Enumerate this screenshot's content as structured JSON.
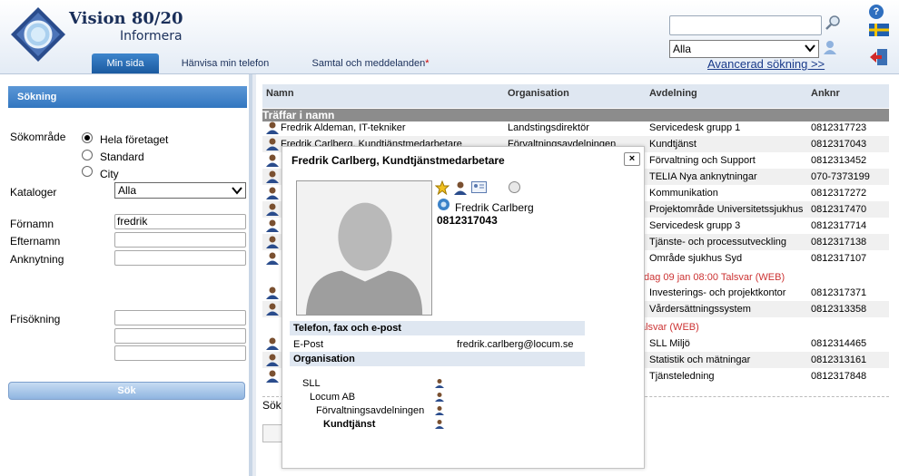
{
  "app": {
    "title": "Vision 80/20",
    "subtitle": "Informera"
  },
  "tabs": [
    {
      "label": "Min sida",
      "active": true
    },
    {
      "label": "Hänvisa min telefon"
    },
    {
      "label": "Samtal och meddelanden",
      "star": "*"
    }
  ],
  "search": {
    "value": "",
    "scope": "Alla",
    "advanced": "Avancerad sökning >>"
  },
  "left": {
    "header": "Sökning",
    "area_label": "Sökområde",
    "radios": [
      {
        "label": "Hela företaget",
        "checked": true
      },
      {
        "label": "Standard",
        "checked": false
      },
      {
        "label": "City",
        "checked": false
      }
    ],
    "kataloger_label": "Kataloger",
    "kataloger_value": "Alla",
    "fornamn_label": "Förnamn",
    "fornamn_value": "fredrik",
    "efternamn_label": "Efternamn",
    "anknytning_label": "Anknytning",
    "frisokning_label": "Frisökning",
    "button": "Sök"
  },
  "table": {
    "headers": [
      "Namn",
      "Organisation",
      "Avdelning",
      "Anknr"
    ],
    "group": "Träffar i namn",
    "rows": [
      {
        "name": "Fredrik Aldeman, IT-tekniker",
        "org": "Landstingsdirektör",
        "dept": "Servicedesk grupp 1",
        "ext": "0812317723"
      },
      {
        "name": "Fredrik Carlberg, Kundtjänstmedarbetare",
        "org": "Förvaltningsavdelningen",
        "dept": "Kundtjänst",
        "ext": "0812317043"
      },
      {
        "name": "",
        "org": "",
        "dept": "Förvaltning och Support",
        "ext": "0812313452"
      },
      {
        "name": "",
        "org": "",
        "dept": "TELIA Nya anknytningar",
        "ext": "070-7373199"
      },
      {
        "name": "",
        "org": "",
        "dept": "Kommunikation",
        "ext": "0812317272"
      },
      {
        "name": "",
        "org": "",
        "dept": "Projektområde Universitetssjukhus",
        "ext": "0812317470"
      },
      {
        "name": "",
        "org": "",
        "dept": "Servicedesk grupp 3",
        "ext": "0812317714"
      },
      {
        "name": "",
        "org": "",
        "dept": "Tjänste- och processutveckling",
        "ext": "0812317138"
      },
      {
        "name": "",
        "org": "",
        "dept": "Område sjukhus Syd",
        "ext": "0812317107"
      }
    ],
    "notice1": "dag 09 jan 08:00 Talsvar (WEB)",
    "rows2": [
      {
        "dept": "Investerings- och projektkontor",
        "ext": "0812317371"
      },
      {
        "dept": "Vårdersättningssystem",
        "ext": "0812313358"
      }
    ],
    "notice2": "alsvar (WEB)",
    "rows3": [
      {
        "dept": "SLL Miljö",
        "ext": "0812314465"
      },
      {
        "dept": "Statistik och mätningar",
        "ext": "0812313161"
      },
      {
        "dept": "Tjänsteledning",
        "ext": "0812317848"
      }
    ],
    "sok_label": "Sök"
  },
  "popup": {
    "title": "Fredrik Carlberg, Kundtjänstmedarbetare",
    "close": "×",
    "name": "Fredrik Carlberg",
    "number": "0812317043",
    "contact_header": "Telefon, fax och e-post",
    "email_label": "E-Post",
    "email_value": "fredrik.carlberg@locum.se",
    "org_header": "Organisation",
    "org_tree": [
      "SLL",
      "Locum AB",
      "Förvaltningsavdelningen",
      "Kundtjänst"
    ]
  },
  "colors": {
    "accent": "#3276c0",
    "header_text": "#1a2f5a",
    "notice": "#cc3333"
  }
}
